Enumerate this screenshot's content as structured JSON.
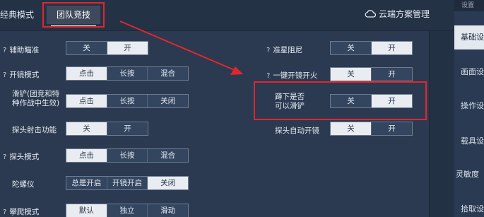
{
  "tabs": {
    "classic": "经典模式",
    "team": "团队竞技"
  },
  "cloud": {
    "label": "云端方案管理",
    "icon": "cloud-icon"
  },
  "sidebar": {
    "header": "设置",
    "items": [
      "基础设",
      "画面设",
      "操作设",
      "载具设",
      "灵敏度",
      "拾取设"
    ]
  },
  "options_left": [
    {
      "label": "辅助瞄准",
      "help": "?",
      "options": [
        "关",
        "开"
      ],
      "selected": 1
    },
    {
      "label": "开镜模式",
      "help": "?",
      "options": [
        "点击",
        "长按",
        "混合"
      ],
      "selected": 0
    },
    {
      "label": "滑铲(团竞和特种作战中生效)",
      "help": "",
      "options": [
        "点击",
        "长按",
        "关闭"
      ],
      "selected": 0
    },
    {
      "label": "探头射击功能",
      "help": "",
      "options": [
        "关",
        "开"
      ],
      "selected": 0
    },
    {
      "label": "探头模式",
      "help": "?",
      "options": [
        "点击",
        "长按",
        "混合"
      ],
      "selected": 0
    },
    {
      "label": "陀螺仪",
      "help": "",
      "options": [
        "总是开启",
        "开镜开启",
        "关闭"
      ],
      "selected": 2
    },
    {
      "label": "攀爬模式",
      "help": "?",
      "options": [
        "默认",
        "独立",
        "滑动"
      ],
      "selected": 0
    }
  ],
  "options_right": [
    {
      "label": "准星阻尼",
      "help": "?",
      "options": [
        "关",
        "开"
      ],
      "selected": 1
    },
    {
      "label": "一键开镜开火",
      "help": "?",
      "options": [
        "关",
        "开"
      ],
      "selected": 0
    },
    {
      "label": "蹲下是否可以滑铲",
      "help": "",
      "options": [
        "关",
        "开"
      ],
      "selected": 1
    },
    {
      "label": "探头自动开镜",
      "help": "",
      "options": [
        "关",
        "开"
      ],
      "selected": 0
    }
  ],
  "colors": {
    "annotation": "#e2262e",
    "selected_bg": "#e9edf2",
    "panel": "#2b3a50"
  }
}
